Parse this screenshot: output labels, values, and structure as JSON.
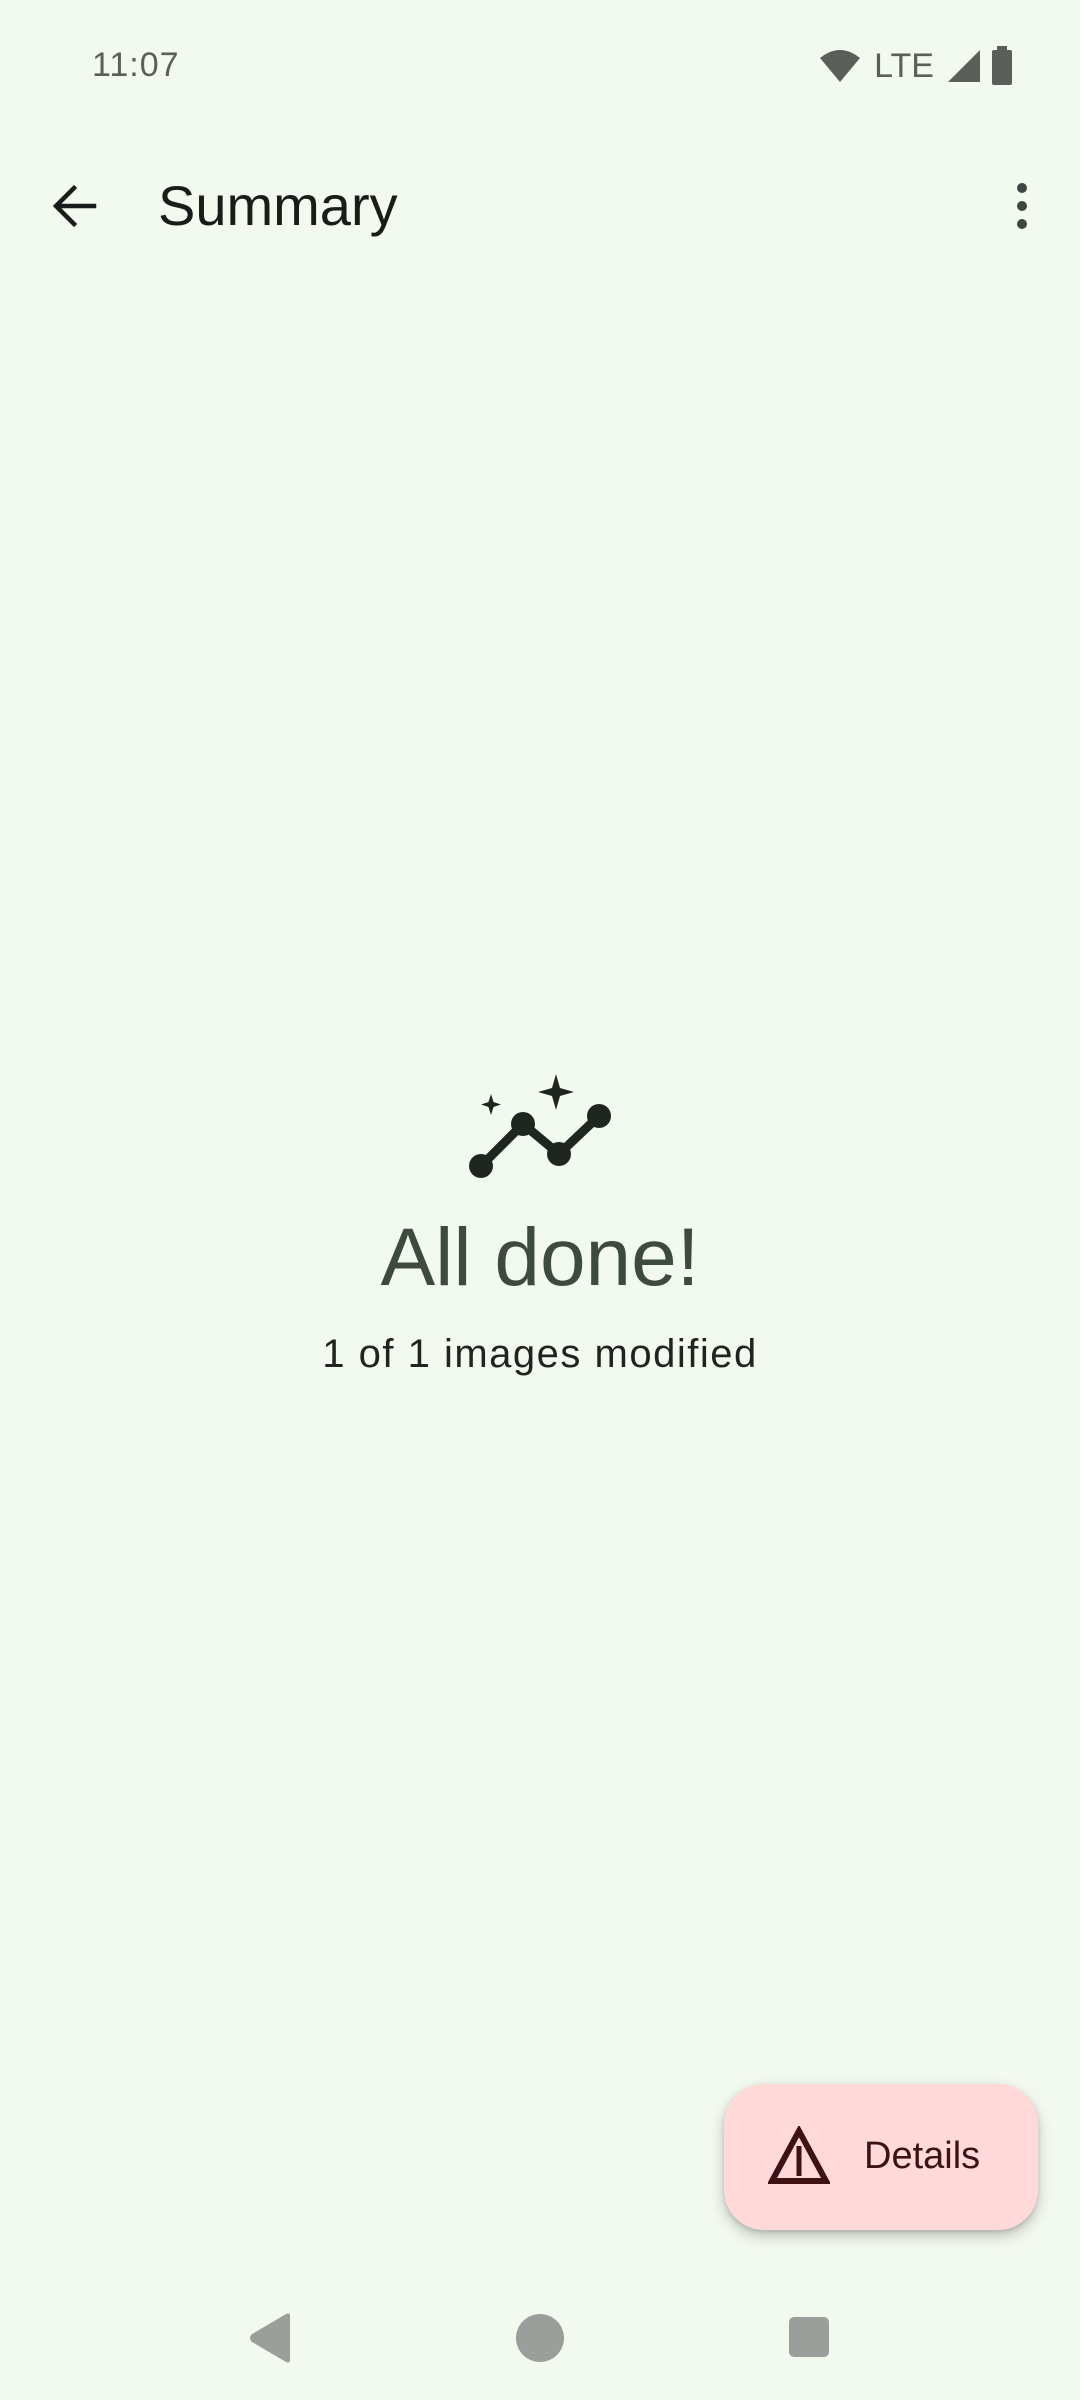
{
  "status_bar": {
    "time": "11:07",
    "network_label": "LTE",
    "icons": [
      "wifi-icon",
      "cell-signal-icon",
      "battery-icon"
    ]
  },
  "app_bar": {
    "title": "Summary",
    "back_icon": "arrow-back-icon",
    "menu_icon": "more-vert-icon"
  },
  "result": {
    "icon": "auto-graph-sparkle-icon",
    "heading": "All done!",
    "subtitle": "1 of 1 images modified"
  },
  "fab": {
    "label": "Details",
    "icon": "warning-triangle-icon"
  },
  "nav_bar": {
    "icons": [
      "nav-back-icon",
      "nav-home-icon",
      "nav-recents-icon"
    ]
  },
  "colors": {
    "background": "#f2f9ef",
    "heading": "#3d4a3f",
    "fab_background": "#ffdad8",
    "fab_foreground": "#3f1113"
  }
}
